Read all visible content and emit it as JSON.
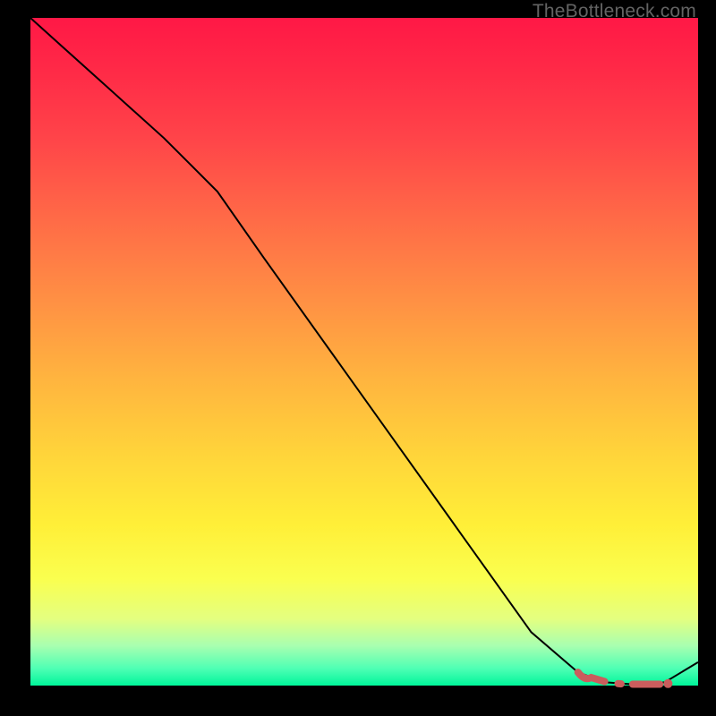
{
  "watermark": "TheBottleneck.com",
  "colors": {
    "background": "#000000",
    "line": "#000000",
    "dash": "#cb5d5d"
  },
  "chart_data": {
    "type": "line",
    "title": "",
    "xlabel": "",
    "ylabel": "",
    "xlim": [
      0,
      100
    ],
    "ylim": [
      0,
      100
    ],
    "grid": false,
    "legend": false,
    "series": [
      {
        "name": "curve",
        "style": "solid-black",
        "x": [
          0,
          5,
          10,
          15,
          20,
          24,
          28,
          35,
          45,
          55,
          65,
          75,
          82,
          86,
          90,
          93,
          95,
          100
        ],
        "y": [
          100,
          95.5,
          91,
          86.5,
          82,
          78,
          74,
          64,
          50,
          36,
          22,
          8,
          2,
          0.5,
          0.2,
          0.2,
          0.5,
          3.5
        ]
      },
      {
        "name": "highlight",
        "style": "thick-dashed-pink",
        "x": [
          82,
          84,
          86,
          88,
          90,
          92,
          94,
          95.5
        ],
        "y": [
          2.0,
          1.2,
          0.6,
          0.3,
          0.2,
          0.2,
          0.2,
          0.3
        ]
      }
    ],
    "annotations": [
      {
        "type": "point",
        "name": "highlight-end-dot",
        "x": 95.5,
        "y": 0.3
      }
    ]
  }
}
